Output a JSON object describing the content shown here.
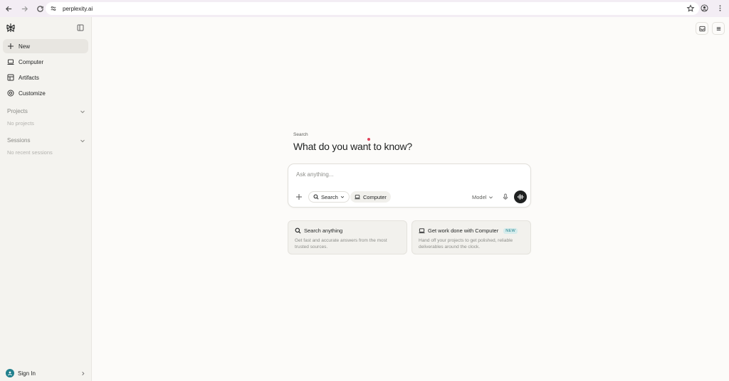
{
  "browser": {
    "url": "perplexity.ai"
  },
  "sidebar": {
    "items": [
      {
        "label": "New",
        "icon": "plus-icon"
      },
      {
        "label": "Computer",
        "icon": "laptop-icon"
      },
      {
        "label": "Artifacts",
        "icon": "artifacts-icon"
      },
      {
        "label": "Customize",
        "icon": "settings-circle-icon"
      }
    ],
    "projects": {
      "title": "Projects",
      "empty": "No projects"
    },
    "sessions": {
      "title": "Sessions",
      "empty": "No recent sessions"
    },
    "signin_label": "Sign In"
  },
  "main": {
    "mode_label": "Search",
    "headline": "What do you want to know?",
    "composer": {
      "placeholder": "Ask anything...",
      "search_pill": "Search",
      "computer_pill": "Computer",
      "model_label": "Model"
    },
    "cards": [
      {
        "title": "Search anything",
        "desc": "Get fast and accurate answers from the most trusted sources.",
        "badge": ""
      },
      {
        "title": "Get work done with Computer",
        "desc": "Hand off your projects to get polished, reliable deliverables around the clock.",
        "badge": "NEW"
      }
    ]
  },
  "colors": {
    "accent": "#21808d",
    "background": "#fcfbf9",
    "sidebar": "#f4f3ef"
  }
}
